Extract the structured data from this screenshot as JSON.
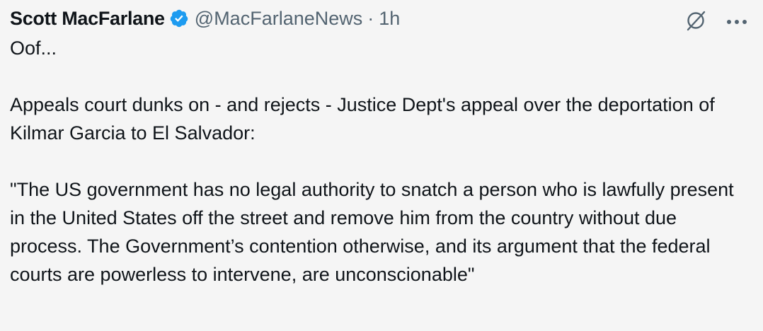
{
  "author": {
    "name": "Scott MacFarlane",
    "handle": "@MacFarlaneNews",
    "separator": "·",
    "time": "1h"
  },
  "icons": {
    "verified": "verified-badge-icon",
    "grok": "grok-icon",
    "more": "more-options-icon"
  },
  "colors": {
    "verified": "#1d9bf0",
    "secondary_text": "#536471",
    "primary_text": "#0f1419",
    "background": "#f5f5f5"
  },
  "tweet": {
    "paragraphs": [
      "Oof...",
      "Appeals court dunks on - and rejects - Justice Dept's appeal over the deportation of Kilmar Garcia to El Salvador:",
      "\"The US government has no legal authority to snatch a person who is lawfully present in the United States off the street and remove him from the country without  due process. The Government’s contention otherwise, and its argument that the federal  courts are powerless to intervene, are unconscionable\""
    ]
  }
}
